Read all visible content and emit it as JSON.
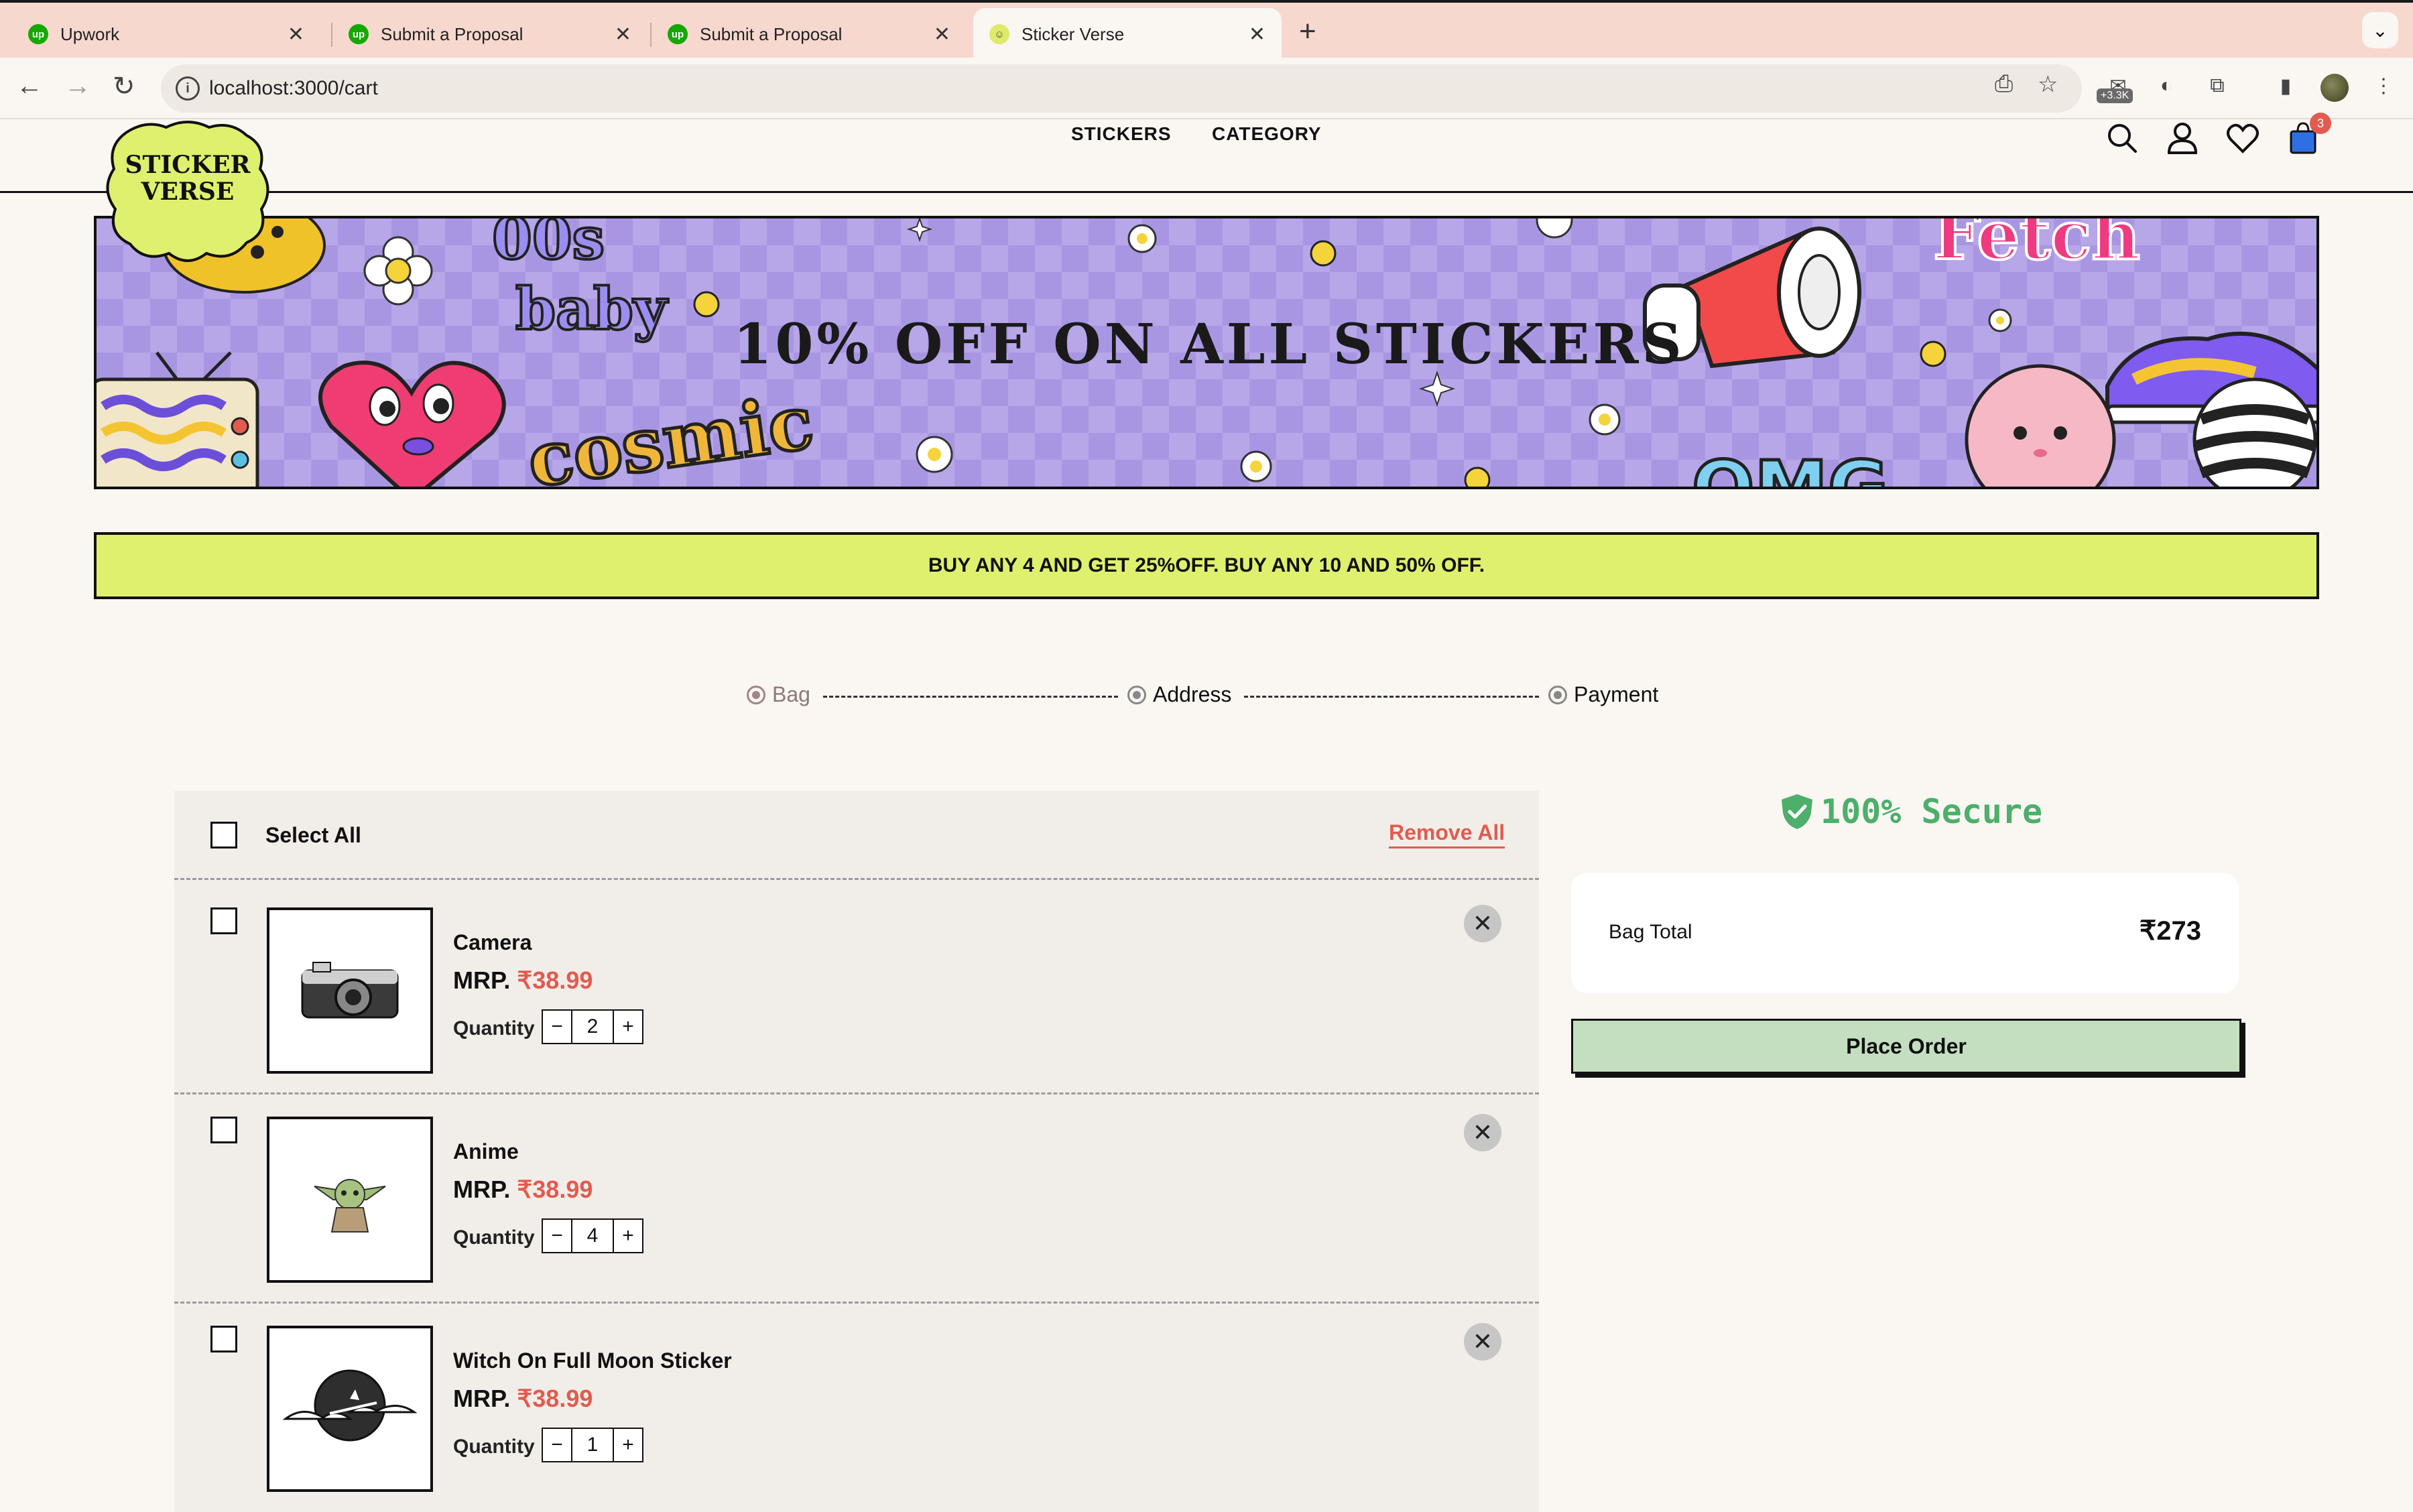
{
  "browser": {
    "tabs": [
      {
        "title": "Upwork",
        "favicon": "up"
      },
      {
        "title": "Submit a Proposal",
        "favicon": "up"
      },
      {
        "title": "Submit a Proposal",
        "favicon": "up"
      },
      {
        "title": "Sticker Verse",
        "favicon": "sv"
      }
    ],
    "url": "localhost:3000/cart",
    "extension_badge": "+3.3K"
  },
  "site": {
    "logo_line1": "STICKER",
    "logo_line2": "VERSE",
    "nav": [
      "STICKERS",
      "CATEGORY"
    ],
    "cart_count": "3"
  },
  "banner": {
    "title": "10% OFF ON ALL STICKERS"
  },
  "offer": "BUY ANY 4 AND GET 25%OFF. BUY ANY 10 AND 50% OFF.",
  "steps": [
    "Bag",
    "Address",
    "Payment"
  ],
  "cart": {
    "select_all": "Select All",
    "remove_all": "Remove All",
    "price_prefix": "MRP.",
    "qty_label": "Quantity",
    "items": [
      {
        "name": "Camera",
        "price": "₹38.99",
        "qty": "2"
      },
      {
        "name": "Anime",
        "price": "₹38.99",
        "qty": "4"
      },
      {
        "name": "Witch On Full Moon Sticker",
        "price": "₹38.99",
        "qty": "1"
      }
    ]
  },
  "summary": {
    "secure": "100% Secure",
    "bag_total_label": "Bag Total",
    "bag_total_value": "₹273",
    "place_order": "Place Order"
  },
  "colors": {
    "accent_red": "#e25b4f",
    "offer_bg": "#dff06e",
    "order_btn": "#c4dfc0",
    "secure_green": "#4caf6a"
  }
}
